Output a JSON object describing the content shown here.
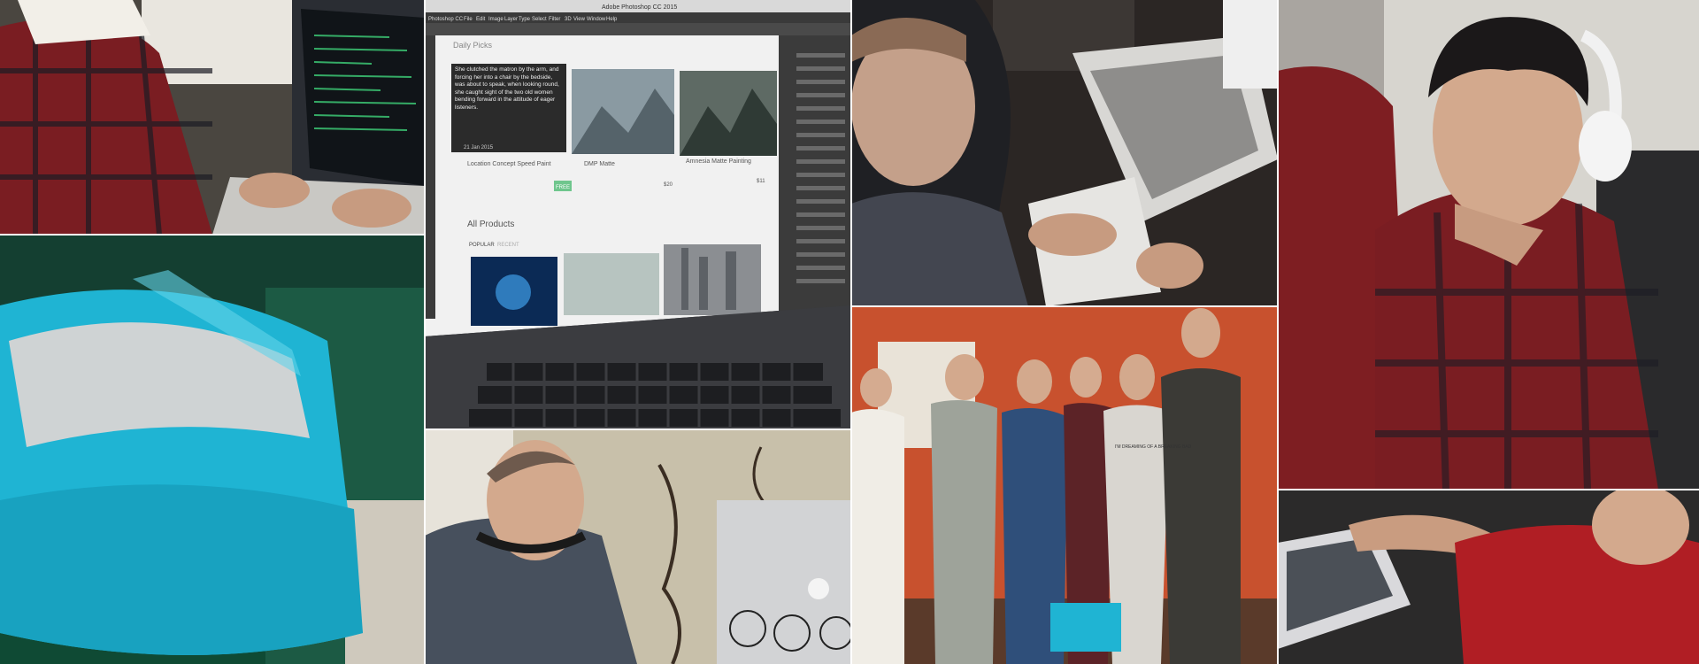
{
  "collage": {
    "tiles": [
      {
        "id": "developer-laptop-plaid"
      },
      {
        "id": "photoshop-laptop-screen"
      },
      {
        "id": "developer-white-laptop"
      },
      {
        "id": "developer-headphones"
      },
      {
        "id": "cyan-cake-closeup"
      },
      {
        "id": "team-group-photo"
      },
      {
        "id": "man-with-macbook"
      },
      {
        "id": "man-red-shirt-laptop"
      }
    ]
  },
  "photoshop_screen": {
    "app_title": "Adobe Photoshop CC 2015",
    "menu": [
      "Photoshop CC",
      "File",
      "Edit",
      "Image",
      "Layer",
      "Type",
      "Select",
      "Filter",
      "3D",
      "View",
      "Window",
      "Help"
    ],
    "section_heading": "Daily Picks",
    "quote": "She clutched the matron by the arm, and forcing her into a chair by the bedside, was about to speak, when looking round, she caught sight of the two old women bending forward in the attitude of eager listeners.",
    "date": "21 Jan 2015",
    "cards": [
      {
        "title": "Location Concept Speed Paint",
        "price": "FREE"
      },
      {
        "title": "DMP Matte",
        "price": "$20"
      },
      {
        "title": "Amnesia Matte Painting",
        "price": "$11"
      }
    ],
    "products_heading": "All Products",
    "filter_popular": "POPULAR",
    "filter_recent": "RECENT"
  },
  "tshirt_text": "I'M DREAMING OF A BREAKING BAD",
  "colors": {
    "cake_cyan": "#1fb4d3",
    "wall_orange": "#c8512e",
    "plaid_red": "#7a1d22"
  }
}
